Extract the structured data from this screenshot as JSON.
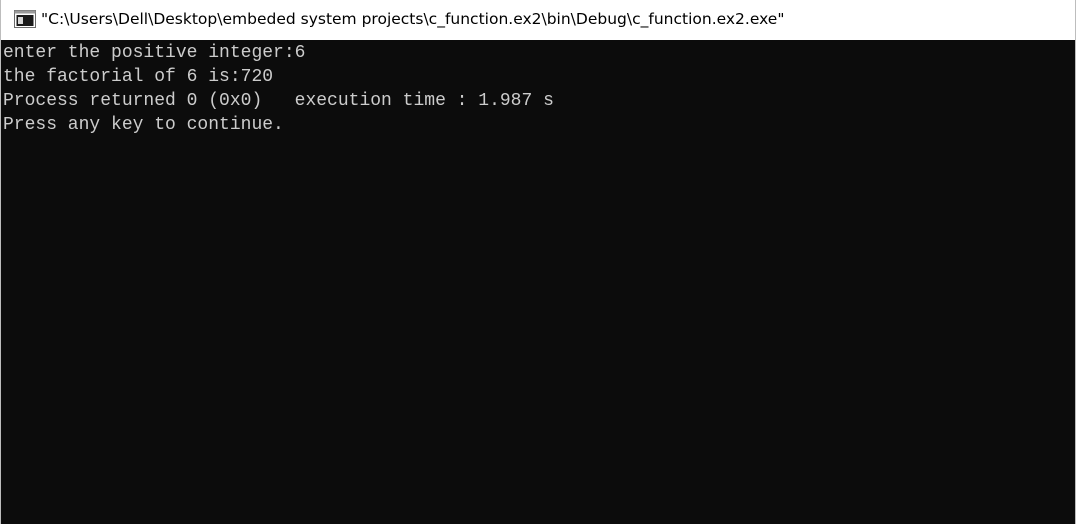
{
  "window": {
    "title": "\"C:\\Users\\Dell\\Desktop\\embeded system projects\\c_function.ex2\\bin\\Debug\\c_function.ex2.exe\"",
    "icon": "console-window-icon"
  },
  "console": {
    "lines": [
      "enter the positive integer:6",
      "the factorial of 6 is:720",
      "Process returned 0 (0x0)   execution time : 1.987 s",
      "Press any key to continue."
    ]
  },
  "colors": {
    "console_background": "#0c0c0c",
    "console_text": "#cccccc",
    "titlebar_background": "#ffffff"
  }
}
